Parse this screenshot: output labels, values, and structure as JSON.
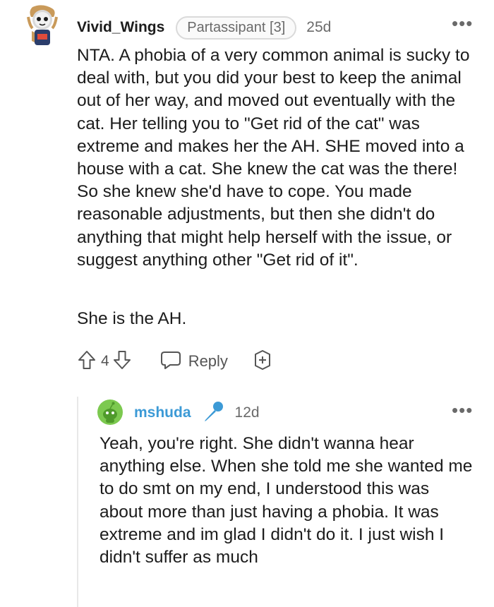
{
  "comment1": {
    "username": "Vivid_Wings",
    "flair": "Partassipant [3]",
    "age": "25d",
    "more": "•••",
    "paragraphs": [
      "NTA. A phobia of a very common animal is sucky to deal with, but you did your best to keep the animal out of her way, and moved out eventually with the cat. Her telling you to \"Get rid of the cat\" was extreme and makes her the AH. SHE moved into a house with a cat. She knew the cat was the there! So she knew she'd have to cope. You made reasonable adjustments, but then she didn't do anything that might help herself with the issue, or suggest anything other \"Get rid of it\".",
      "She is the AH."
    ],
    "votes": "4",
    "reply_label": "Reply",
    "icons": [
      "upvote-icon",
      "downvote-icon",
      "reply-icon",
      "award-icon"
    ]
  },
  "comment2": {
    "username": "mshuda",
    "age": "12d",
    "more": "•••",
    "paragraphs": [
      "Yeah, you're right. She didn't wanna hear anything else. When she told me she wanted me to do smt on my end, I understood this was about more than just having a phobia. It was extreme and im glad I didn't do it. I just wish I didn't suffer as much"
    ],
    "icons": [
      "mic-icon"
    ]
  },
  "colors": {
    "username2": "#3c9ad6",
    "meta_gray": "#6a6a6a",
    "thread_line": "#e8e8e8"
  }
}
